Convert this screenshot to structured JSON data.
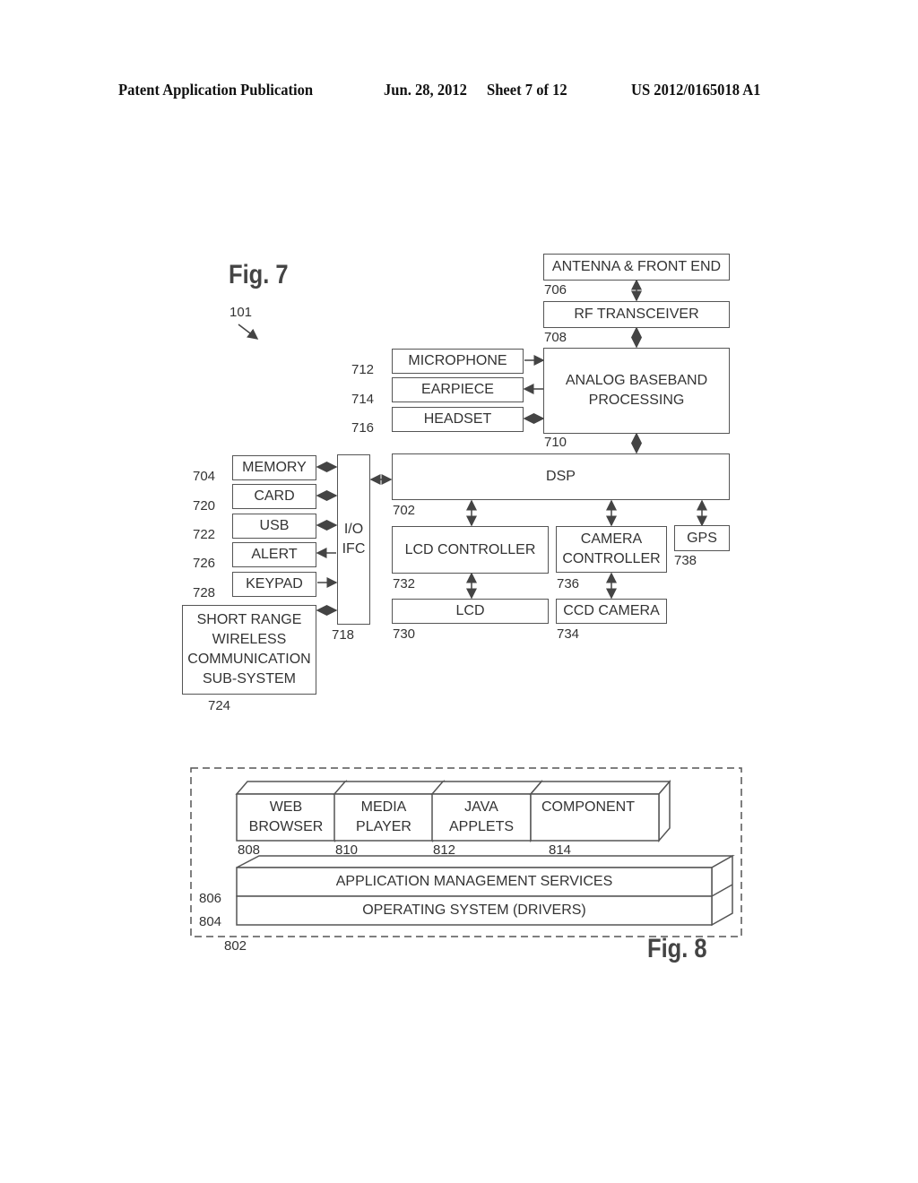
{
  "header": {
    "publication": "Patent Application Publication",
    "date": "Jun. 28, 2012",
    "sheet": "Sheet 7 of 12",
    "number": "US 2012/0165018 A1"
  },
  "fig7": {
    "title": "Fig. 7",
    "device_ref": "101",
    "blocks": {
      "antenna": {
        "label": "ANTENNA & FRONT END",
        "ref": "706"
      },
      "rf": {
        "label": "RF TRANSCEIVER",
        "ref": "708"
      },
      "analog": {
        "label": "ANALOG BASEBAND\nPROCESSING",
        "ref": "710"
      },
      "microphone": {
        "label": "MICROPHONE",
        "ref": "712"
      },
      "earpiece": {
        "label": "EARPIECE",
        "ref": "714"
      },
      "headset": {
        "label": "HEADSET",
        "ref": "716"
      },
      "memory": {
        "label": "MEMORY",
        "ref": "704"
      },
      "card": {
        "label": "CARD",
        "ref": "720"
      },
      "usb": {
        "label": "USB",
        "ref": "722"
      },
      "alert": {
        "label": "ALERT",
        "ref": "726"
      },
      "keypad": {
        "label": "KEYPAD",
        "ref": "728"
      },
      "shortrange": {
        "label": "SHORT RANGE\nWIRELESS\nCOMMUNICATION\nSUB-SYSTEM",
        "ref": "724"
      },
      "io": {
        "label": "I/O\nIFC",
        "ref": "718"
      },
      "dsp": {
        "label": "DSP",
        "ref": "702"
      },
      "lcdctrl": {
        "label": "LCD CONTROLLER",
        "ref": "732"
      },
      "camctrl": {
        "label": "CAMERA\nCONTROLLER",
        "ref": "736"
      },
      "gps": {
        "label": "GPS",
        "ref": "738"
      },
      "lcd": {
        "label": "LCD",
        "ref": "730"
      },
      "ccd": {
        "label": "CCD CAMERA",
        "ref": "734"
      }
    }
  },
  "fig8": {
    "title": "Fig. 8",
    "container_ref": "802",
    "apps": [
      {
        "label": "WEB\nBROWSER",
        "ref": "808"
      },
      {
        "label": "MEDIA\nPLAYER",
        "ref": "810"
      },
      {
        "label": "JAVA\nAPPLETS",
        "ref": "812"
      },
      {
        "label": "COMPONENT",
        "ref": "814"
      }
    ],
    "ams": {
      "label": "APPLICATION MANAGEMENT SERVICES",
      "ref": "806"
    },
    "os": {
      "label": "OPERATING SYSTEM (DRIVERS)",
      "ref": "804"
    }
  }
}
